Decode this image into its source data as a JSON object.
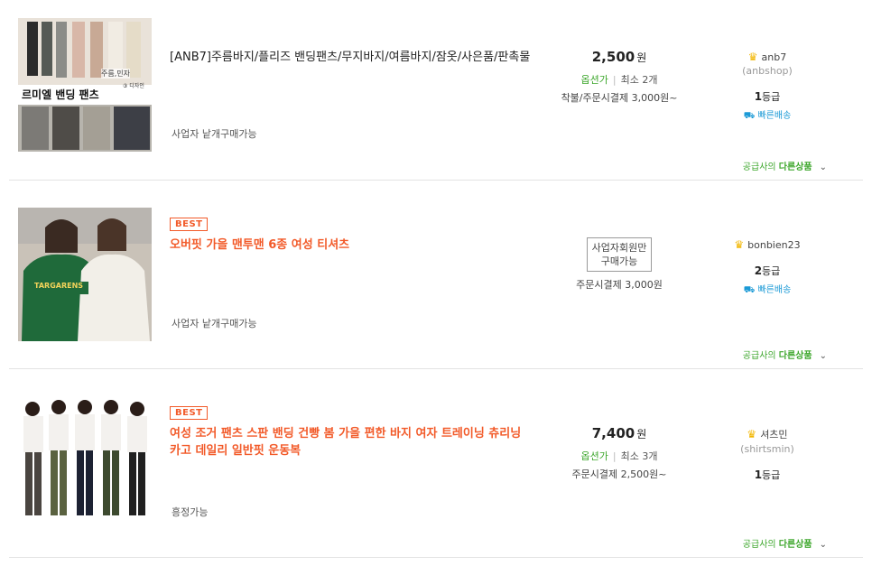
{
  "products": [
    {
      "badge": "",
      "title": "[ANB7]주름바지/플리즈 밴딩팬츠/무지바지/여름바지/잠옷/사은품/판촉물",
      "thumb_text_main": "르미엘 밴딩 팬츠",
      "thumb_text_sub": "주름,민자",
      "thumb_text_count": "③ 디자인",
      "note": "사업자 낱개구매가능",
      "price": "2,500",
      "won": "원",
      "option_label": "옵션가",
      "min_order": "최소 2개",
      "shipping": "착불/주문시결제 3,000원~",
      "member_only": "",
      "seller_name": "anb7",
      "seller_id": "(anbshop)",
      "grade_num": "1",
      "grade_label": "등급",
      "fast_label": "빠른배송",
      "more_prefix": "공급사의",
      "more_label": "다른상품"
    },
    {
      "badge": "BEST",
      "title": "오버핏 가을 맨투맨 6종 여성 티셔츠",
      "thumb_text_main": "TARGARENS",
      "note": "사업자 낱개구매가능",
      "member_only_line1": "사업자회원만",
      "member_only_line2": "구매가능",
      "shipping": "주문시결제 3,000원",
      "seller_name": "bonbien23",
      "grade_num": "2",
      "grade_label": "등급",
      "fast_label": "빠른배송",
      "more_prefix": "공급사의",
      "more_label": "다른상품"
    },
    {
      "badge": "BEST",
      "title": "여성 조거 팬츠 스판 밴딩 건빵 봄 가을 편한 바지 여자 트레이닝 츄리닝 카고 데일리 일반핏 운동복",
      "note": "흥정가능",
      "price": "7,400",
      "won": "원",
      "option_label": "옵션가",
      "min_order": "최소 3개",
      "shipping": "주문시결제 2,500원~",
      "seller_name": "셔츠민",
      "seller_id": "(shirtsmin)",
      "grade_num": "1",
      "grade_label": "등급",
      "more_prefix": "공급사의",
      "more_label": "다른상품"
    }
  ],
  "colors": {
    "accent_orange": "#f25a29",
    "green": "#3ea72d",
    "blue": "#1b9ad6",
    "crown": "#f2b600"
  }
}
